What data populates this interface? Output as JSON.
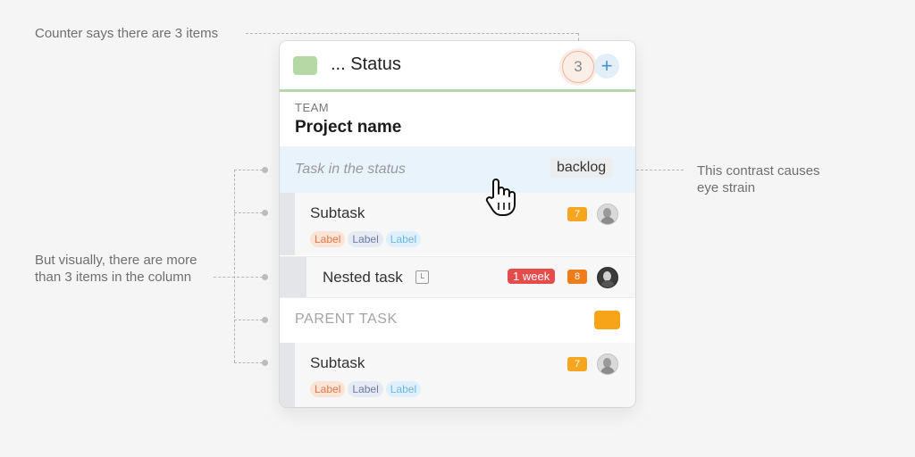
{
  "annotations": {
    "top": "Counter says there are 3 items",
    "right_line1": "This contrast causes",
    "right_line2": "eye strain",
    "left_line1": "But visually, there are more",
    "left_line2": "than 3 items in the column"
  },
  "column": {
    "status_title": "... Status",
    "counter": "3",
    "add_symbol": "+",
    "status_color": "#b5d9a4"
  },
  "team": {
    "label": "TEAM",
    "project": "Project name"
  },
  "task_row": {
    "placeholder": "Task in the status",
    "tag": "backlog"
  },
  "subtask_1": {
    "title": "Subtask",
    "badge": "7",
    "labels": [
      "Label",
      "Label",
      "Label"
    ]
  },
  "nested_task": {
    "title": "Nested task",
    "duration": "1 week",
    "badge": "8"
  },
  "parent_task": {
    "title": "PARENT TASK",
    "color": "#f7a418"
  },
  "subtask_2": {
    "title": "Subtask",
    "badge": "7",
    "labels": [
      "Label",
      "Label",
      "Label"
    ]
  }
}
